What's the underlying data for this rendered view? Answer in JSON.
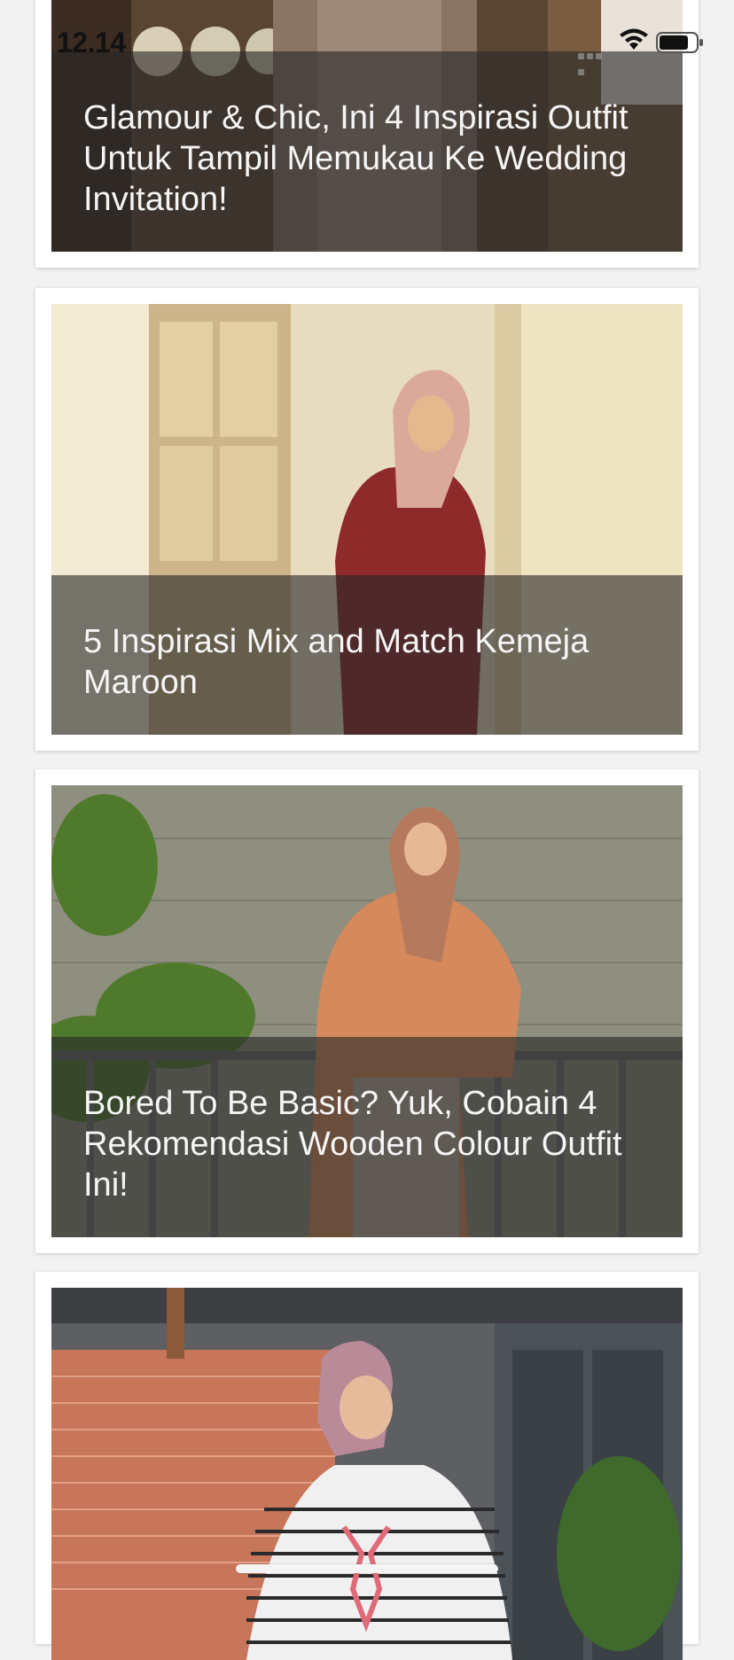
{
  "status_bar": {
    "time": "12.14",
    "icons": [
      "cellular-signal-icon",
      "wifi-icon",
      "battery-icon"
    ]
  },
  "articles": [
    {
      "title": "Glamour & Chic, Ini 4 Inspirasi Outfit Untuk Tampil Memukau Ke Wedding Invitation!"
    },
    {
      "title": "5 Inspirasi Mix and Match Kemeja Maroon"
    },
    {
      "title": "Bored To Be Basic? Yuk, Cobain 4 Rekomendasi Wooden Colour Outfit Ini!"
    },
    {
      "title": ""
    }
  ],
  "colors": {
    "background": "#f2f2f2",
    "card": "#ffffff",
    "overlay": "rgba(40,40,40,0.62)",
    "title_text": "#f5f5f5"
  }
}
